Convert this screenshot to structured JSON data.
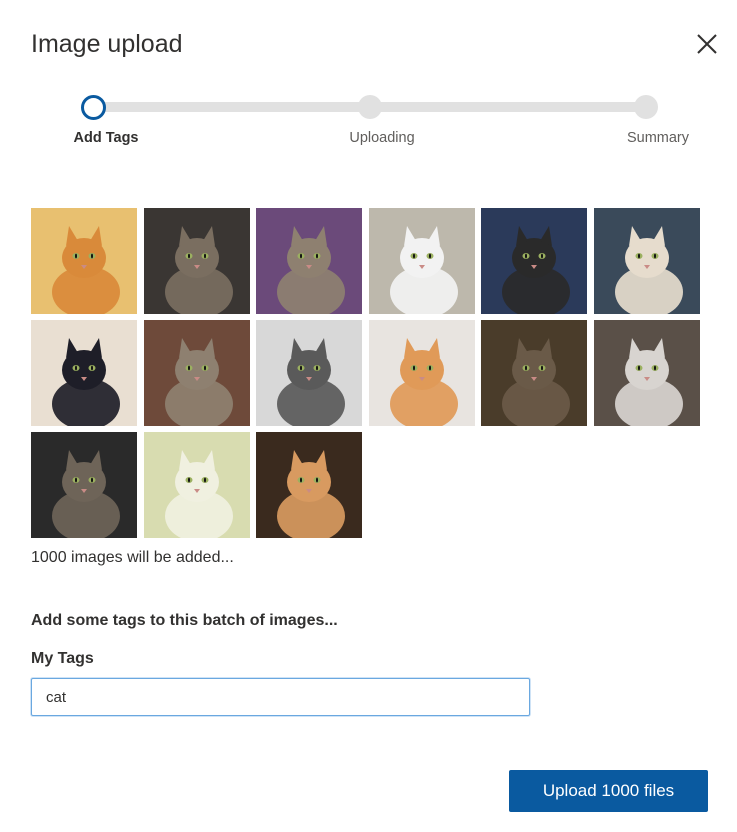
{
  "dialog": {
    "title": "Image upload",
    "close_icon": "close-icon"
  },
  "steps": [
    {
      "label": "Add Tags",
      "state": "active"
    },
    {
      "label": "Uploading",
      "state": "pending"
    },
    {
      "label": "Summary",
      "state": "pending"
    }
  ],
  "thumbnails": {
    "icon": "cat-photo-thumbnail",
    "items": [
      {
        "bg": "#e8c070",
        "fur": "#d98a3a"
      },
      {
        "bg": "#3a3633",
        "fur": "#7a6e60"
      },
      {
        "bg": "#6b4a7a",
        "fur": "#8e8070"
      },
      {
        "bg": "#bdb8ac",
        "fur": "#f2f2f2"
      },
      {
        "bg": "#2b3a5a",
        "fur": "#2a2a2a"
      },
      {
        "bg": "#3a4a5a",
        "fur": "#e6dccd"
      },
      {
        "bg": "#e9dfd2",
        "fur": "#1e1e28"
      },
      {
        "bg": "#6e4a3a",
        "fur": "#8e8070"
      },
      {
        "bg": "#d8d8d8",
        "fur": "#5a5a5a"
      },
      {
        "bg": "#e8e4e0",
        "fur": "#e09a58"
      },
      {
        "bg": "#4a3c2a",
        "fur": "#6a5a48"
      },
      {
        "bg": "#5a5048",
        "fur": "#d8d4d0"
      },
      {
        "bg": "#2a2a2a",
        "fur": "#6e6458"
      },
      {
        "bg": "#d8dcb0",
        "fur": "#f0f0e0"
      },
      {
        "bg": "#3a2a1e",
        "fur": "#d89a60"
      }
    ]
  },
  "summary_text": "1000 images will be added...",
  "tags_prompt": "Add some tags to this batch of images...",
  "tags_field": {
    "label": "My Tags",
    "value": "cat",
    "placeholder": ""
  },
  "upload_button_label": "Upload 1000 files",
  "colors": {
    "accent": "#0a5aa0",
    "track": "#e1e1e1"
  }
}
